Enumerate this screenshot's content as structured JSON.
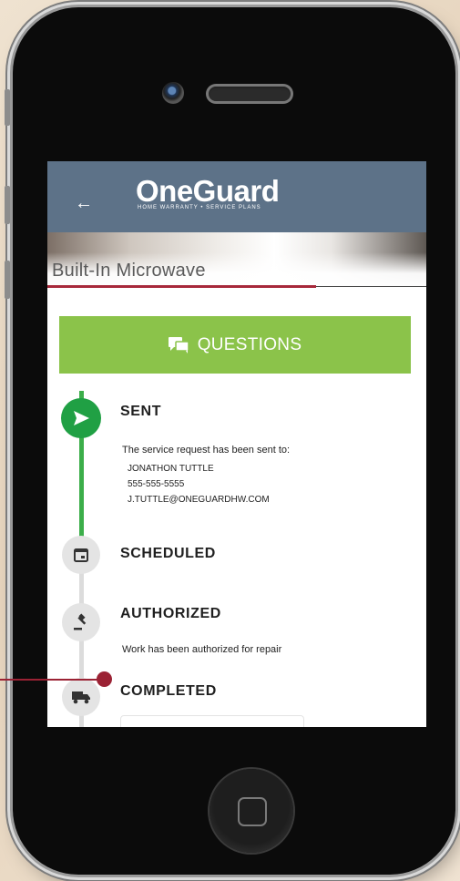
{
  "header": {
    "back_glyph": "←",
    "logo_text": "OneGuard",
    "logo_tagline": "HOME WARRANTY • SERVICE PLANS",
    "bg_color": "#5d7288"
  },
  "appliance": {
    "title": "Built-In Microwave",
    "accent_color": "#a7283a"
  },
  "questions_button": {
    "label": "QUESTIONS",
    "icon": "chat-icon",
    "bg_color": "#8bc34a"
  },
  "timeline": {
    "sent": {
      "title": "SENT",
      "text": "The service request has been sent to:",
      "contact_name": "JONATHON TUTTLE",
      "contact_phone": "555-555-5555",
      "contact_email": "J.TUTTLE@ONEGUARDHW.COM",
      "icon": "send-icon",
      "color": "#20a044"
    },
    "scheduled": {
      "title": "SCHEDULED",
      "icon": "calendar-icon"
    },
    "authorized": {
      "title": "AUTHORIZED",
      "text": "Work has been authorized for repair",
      "icon": "gavel-icon"
    },
    "completed": {
      "title": "COMPLETED",
      "icon": "truck-icon"
    }
  }
}
